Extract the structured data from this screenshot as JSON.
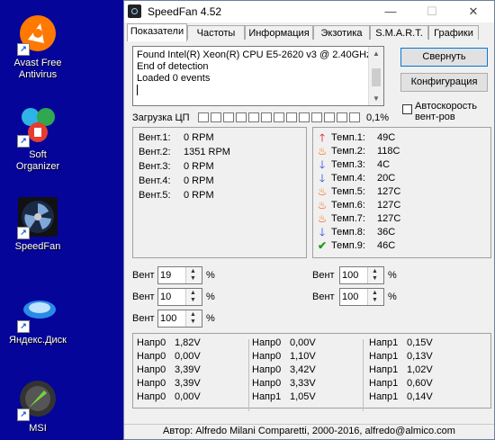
{
  "desktop": {
    "icons": [
      {
        "label": "Avast Free Antivirus",
        "line1": "Avast Free",
        "line2": "Antivirus"
      },
      {
        "label": "Soft Organizer",
        "line1": "Soft",
        "line2": "Organizer"
      },
      {
        "label": "SpeedFan",
        "line1": "SpeedFan",
        "line2": ""
      },
      {
        "label": "Яндекс.Диск",
        "line1": "Яндекс.Диск",
        "line2": ""
      },
      {
        "label": "MSI",
        "line1": "MSI",
        "line2": ""
      }
    ],
    "background": "#05059a"
  },
  "window": {
    "title": "SpeedFan 4.52",
    "controls": {
      "minimize": "—",
      "maximize": "☐",
      "close": "✕"
    }
  },
  "tabs": [
    "Показатели",
    "Частоты",
    "Информация",
    "Экзотика",
    "S.M.A.R.T.",
    "Графики"
  ],
  "log": {
    "lines": [
      "Found Intel(R) Xeon(R) CPU E5-2620 v3 @ 2.40GHz",
      "End of detection",
      "Loaded 0 events"
    ]
  },
  "buttons": {
    "minimize": "Свернуть",
    "config": "Конфигурация"
  },
  "autospeed": {
    "label_line1": "Автоскорость",
    "label_line2": "вент-ров",
    "checked": false
  },
  "cpu": {
    "label": "Загрузка ЦП",
    "percent": "0,1%",
    "segments": 13
  },
  "fans": [
    {
      "name": "Вент.1:",
      "value": "0 RPM"
    },
    {
      "name": "Вент.2:",
      "value": "1351 RPM"
    },
    {
      "name": "Вент.3:",
      "value": "0 RPM"
    },
    {
      "name": "Вент.4:",
      "value": "0 RPM"
    },
    {
      "name": "Вент.5:",
      "value": "0 RPM"
    }
  ],
  "temps": [
    {
      "name": "Темп.1:",
      "value": "49C",
      "icon": "arrow-up"
    },
    {
      "name": "Темп.2:",
      "value": "118C",
      "icon": "fire"
    },
    {
      "name": "Темп.3:",
      "value": "4C",
      "icon": "arrow-down"
    },
    {
      "name": "Темп.4:",
      "value": "20C",
      "icon": "arrow-down"
    },
    {
      "name": "Темп.5:",
      "value": "127C",
      "icon": "fire"
    },
    {
      "name": "Темп.6:",
      "value": "127C",
      "icon": "fire"
    },
    {
      "name": "Темп.7:",
      "value": "127C",
      "icon": "fire"
    },
    {
      "name": "Темп.8:",
      "value": "36C",
      "icon": "arrow-down"
    },
    {
      "name": "Темп.9:",
      "value": "46C",
      "icon": "check"
    }
  ],
  "speed_controls": {
    "label": "Вент",
    "unit": "%",
    "left": [
      "19",
      "10",
      "100"
    ],
    "right": [
      "100",
      "100"
    ]
  },
  "voltages": {
    "col1": [
      {
        "name": "Напр0",
        "value": "1,82V"
      },
      {
        "name": "Напр0",
        "value": "0,00V"
      },
      {
        "name": "Напр0",
        "value": "3,39V"
      },
      {
        "name": "Напр0",
        "value": "3,39V"
      },
      {
        "name": "Напр0",
        "value": "0,00V"
      }
    ],
    "col2": [
      {
        "name": "Напр0",
        "value": "0,00V"
      },
      {
        "name": "Напр0",
        "value": "1,10V"
      },
      {
        "name": "Напр0",
        "value": "3,42V"
      },
      {
        "name": "Напр0",
        "value": "3,33V"
      },
      {
        "name": "Напр1",
        "value": "1,05V"
      }
    ],
    "col3": [
      {
        "name": "Напр1",
        "value": "0,15V"
      },
      {
        "name": "Напр1",
        "value": "0,13V"
      },
      {
        "name": "Напр1",
        "value": "1,02V"
      },
      {
        "name": "Напр1",
        "value": "0,60V"
      },
      {
        "name": "Напр1",
        "value": "0,14V"
      }
    ]
  },
  "status": "Автор: Alfredo Milani Comparetti, 2000-2016, alfredo@almico.com"
}
